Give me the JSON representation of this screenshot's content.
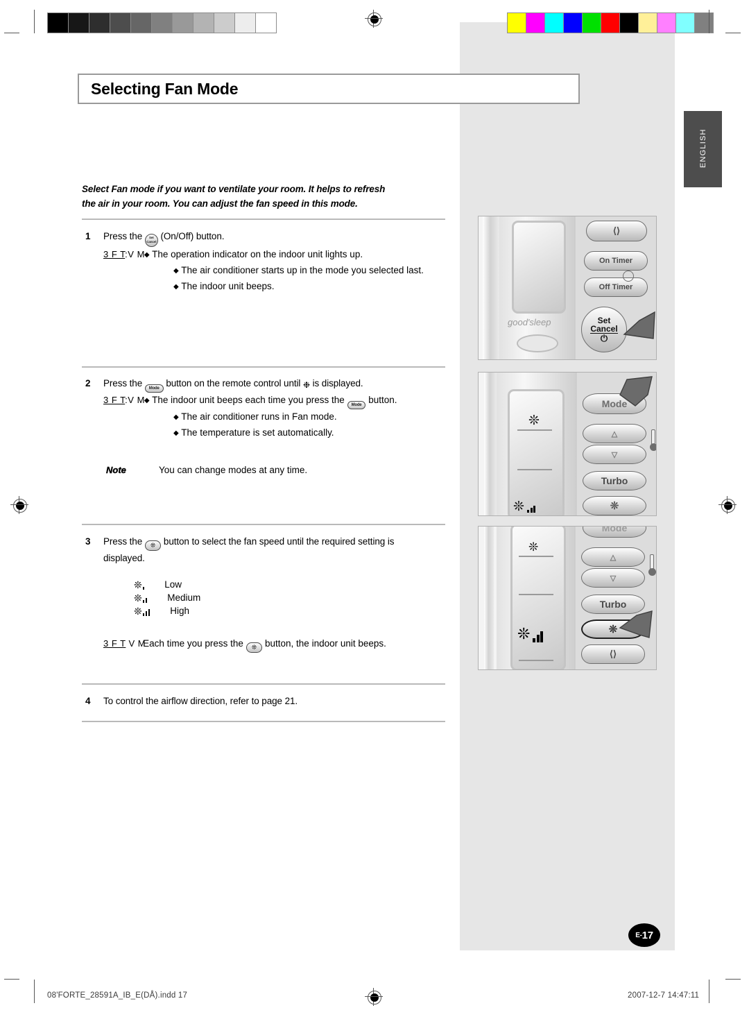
{
  "page": {
    "title": "Selecting Fan Mode",
    "language_tab": "ENGLISH",
    "page_number": "E-17",
    "page_number_prefix": "E-",
    "page_number_value": "17"
  },
  "intro": {
    "line1": "Select Fan mode if you want to ventilate your room. It helps to refresh",
    "line2": "the air in your room. You can adjust the fan speed in this mode."
  },
  "steps": [
    {
      "number": "1",
      "text_before": "Press the",
      "button_glyph": "Set Cancel",
      "text_after": "(On/Off) button.",
      "result_marker": "3 F T:V M",
      "bullets": [
        "The operation indicator on the indoor unit lights up.",
        "The air conditioner starts up in the mode you selected last.",
        "The indoor unit beeps."
      ]
    },
    {
      "number": "2",
      "text_before": "Press the",
      "button_glyph": "Mode",
      "text_mid": "button on the remote control until",
      "text_after": "is displayed.",
      "result_marker": "3 F T:V M",
      "bullets": [
        "The indoor unit beeps each time you press the",
        "The air conditioner runs in Fan mode.",
        "The temperature is set automatically."
      ],
      "bullet1_suffix": "button.",
      "note_label": "Note",
      "note_text": "You can change modes at any time."
    },
    {
      "number": "3",
      "text_before": "Press the",
      "text_after": "button to select the fan speed until the required setting is",
      "text_line2": "displayed.",
      "speeds": [
        {
          "label": "Low",
          "bars": 1
        },
        {
          "label": "Medium",
          "bars": 2
        },
        {
          "label": "High",
          "bars": 3
        }
      ],
      "result_marker": "3 F T  V M",
      "result_before": "Each time you press the",
      "result_after": "button, the indoor unit beeps."
    },
    {
      "number": "4",
      "text": "To control the airflow direction, refer to page 21."
    }
  ],
  "remotes": [
    {
      "name": "remote-power",
      "brand_label": "good'sleep",
      "buttons": [
        "On Timer",
        "Off Timer",
        "Set",
        "Cancel"
      ],
      "swing_icon": "swing-icon",
      "clock_icon": "clock-icon",
      "pointer": "arrow-pointer"
    },
    {
      "name": "remote-mode",
      "buttons": [
        "Mode",
        "Turbo"
      ],
      "up_icon": "triangle-up-icon",
      "down_icon": "triangle-down-icon",
      "thermometer_icon": "thermometer-icon",
      "fan_icon": "fan-icon",
      "lcd_fan_icon": "fan-icon",
      "pointer": "arrow-pointer"
    },
    {
      "name": "remote-fanspeed",
      "buttons": [
        "Mode",
        "Turbo"
      ],
      "up_icon": "triangle-up-icon",
      "down_icon": "triangle-down-icon",
      "thermometer_icon": "thermometer-icon",
      "fan_icon": "fan-icon",
      "swing_icon": "swing-icon",
      "pointer": "arrow-pointer"
    }
  ],
  "footer": {
    "file": "08'FORTE_28591A_IB_E(DÅ).indd   17",
    "timestamp": "2007-12-7   14:47:11"
  },
  "print_marks": {
    "grayscale_steps": [
      "#000000",
      "#171717",
      "#2e2e2e",
      "#4d4d4d",
      "#666666",
      "#808080",
      "#999999",
      "#b3b3b3",
      "#cccccc",
      "#ededed",
      "#ffffff"
    ],
    "color_steps": [
      "#ffff00",
      "#ff00ff",
      "#00ffff",
      "#0000ff",
      "#00e000",
      "#ff0000",
      "#000000",
      "#fff099",
      "#ff80ff",
      "#80ffff",
      "#808080"
    ]
  }
}
